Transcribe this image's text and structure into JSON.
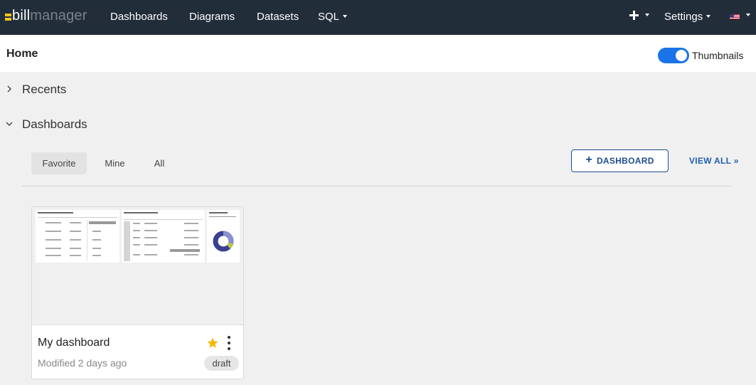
{
  "app": {
    "logo_part1": "bill",
    "logo_part2": "manager"
  },
  "nav": {
    "items": [
      {
        "label": "Dashboards"
      },
      {
        "label": "Diagrams"
      },
      {
        "label": "Datasets"
      },
      {
        "label": "SQL"
      }
    ],
    "settings_label": "Settings"
  },
  "header": {
    "title": "Home",
    "thumbnails_label": "Thumbnails",
    "thumbnails_on": true
  },
  "sections": {
    "recents": {
      "label": "Recents",
      "expanded": false
    },
    "dashboards": {
      "label": "Dashboards",
      "expanded": true
    }
  },
  "filters": {
    "tabs": [
      {
        "label": "Favorite",
        "active": true
      },
      {
        "label": "Mine",
        "active": false
      },
      {
        "label": "All",
        "active": false
      }
    ],
    "add_dashboard_label": "DASHBOARD",
    "view_all_label": "VIEW ALL »"
  },
  "cards": [
    {
      "title": "My dashboard",
      "modified": "Modified 2 days ago",
      "status": "draft",
      "favorite": true
    }
  ],
  "colors": {
    "navbar_bg": "#222d3a",
    "accent": "#1a73e8",
    "logo_yellow": "#f5c518",
    "star": "#f5b800"
  }
}
